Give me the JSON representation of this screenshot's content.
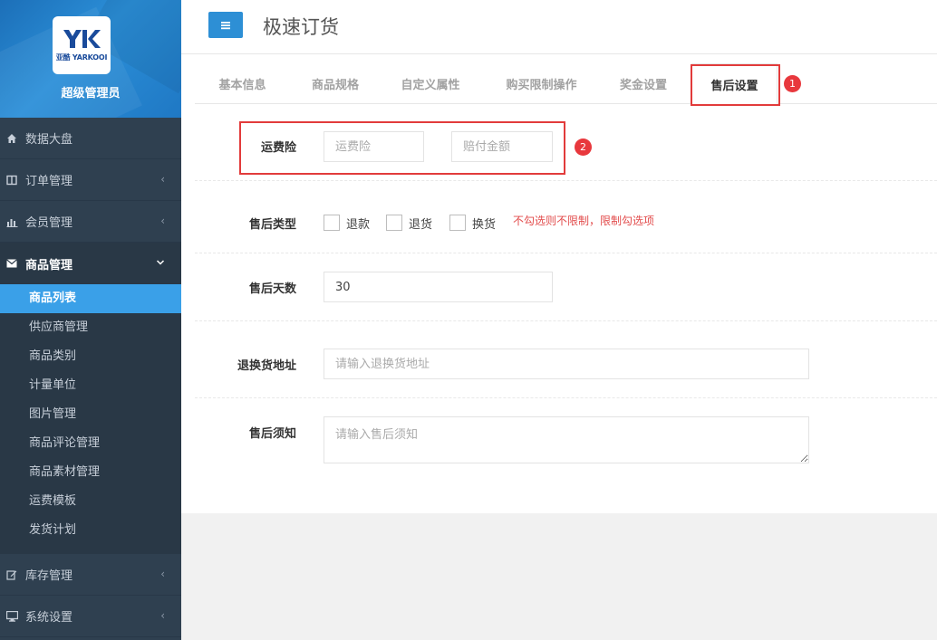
{
  "sidebar": {
    "logo_text": "亚酷 YARKOOI",
    "admin_name": "超级管理员",
    "items": [
      {
        "label": "数据大盘"
      },
      {
        "label": "订单管理"
      },
      {
        "label": "会员管理"
      },
      {
        "label": "商品管理"
      },
      {
        "label": "库存管理"
      },
      {
        "label": "系统设置"
      }
    ],
    "sub_items": [
      {
        "label": "商品列表"
      },
      {
        "label": "供应商管理"
      },
      {
        "label": "商品类别"
      },
      {
        "label": "计量单位"
      },
      {
        "label": "图片管理"
      },
      {
        "label": "商品评论管理"
      },
      {
        "label": "商品素材管理"
      },
      {
        "label": "运费模板"
      },
      {
        "label": "发货计划"
      }
    ]
  },
  "header": {
    "title": "极速订货"
  },
  "tabs": [
    {
      "label": "基本信息"
    },
    {
      "label": "商品规格"
    },
    {
      "label": "自定义属性"
    },
    {
      "label": "购买限制操作"
    },
    {
      "label": "奖金设置"
    },
    {
      "label": "售后设置"
    }
  ],
  "annotations": {
    "badge1": "1",
    "badge2": "2"
  },
  "form": {
    "shipping_insurance": {
      "label": "运费险",
      "insurance_placeholder": "运费险",
      "amount_placeholder": "赔付金额"
    },
    "aftersale_type": {
      "label": "售后类型",
      "options": [
        {
          "label": "退款",
          "checked": false
        },
        {
          "label": "退货",
          "checked": false
        },
        {
          "label": "换货",
          "checked": false
        }
      ],
      "hint": "不勾选则不限制，限制勾选项"
    },
    "aftersale_days": {
      "label": "售后天数",
      "value": "30"
    },
    "return_address": {
      "label": "退换货地址",
      "placeholder": "请输入退换货地址"
    },
    "aftersale_notice": {
      "label": "售后须知",
      "placeholder": "请输入售后须知"
    }
  },
  "colors": {
    "sidebar_bg": "#2f4050",
    "accent": "#3aa0e8",
    "annotation_red": "#e23b3b"
  }
}
